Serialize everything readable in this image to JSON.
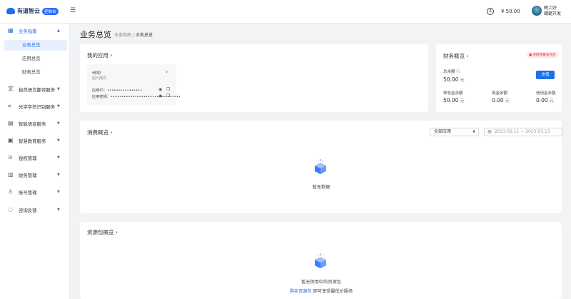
{
  "header": {
    "logo_text": "有道智云",
    "logo_badge": "控制台",
    "balance": "¥ 50.00",
    "user_greeting": "晚上好",
    "user_name": "蜻蜓开发"
  },
  "sidebar": {
    "groups": [
      {
        "label": "业务指南",
        "icon": "grid-icon",
        "chevron": "▲"
      },
      {
        "label": "自然语言翻译服务",
        "icon": "translate-icon",
        "chevron": "▼"
      },
      {
        "label": "光学字符识别服务",
        "icon": "scan-icon",
        "chevron": "▼"
      },
      {
        "label": "智能语音服务",
        "icon": "voice-icon",
        "chevron": "▼"
      },
      {
        "label": "智慧教育服务",
        "icon": "education-icon",
        "chevron": "▼"
      },
      {
        "label": "授权管理",
        "icon": "key-icon",
        "chevron": "▼"
      },
      {
        "label": "财务管理",
        "icon": "wallet-icon",
        "chevron": "▼"
      },
      {
        "label": "账号管理",
        "icon": "user-icon",
        "chevron": "▼"
      },
      {
        "label": "咨询反馈",
        "icon": "chat-icon",
        "chevron": "▼"
      }
    ],
    "sub_items": [
      "业务总览",
      "应用总览",
      "财务总览"
    ]
  },
  "page": {
    "title": "业务总览",
    "breadcrumb_parent": "业务指南",
    "breadcrumb_sep": " / ",
    "breadcrumb_current": "业务总览"
  },
  "my_apps": {
    "title": "我的应用 ›",
    "app_name": "app",
    "app_desc": "图片翻译",
    "app_id_label": "应用ID：",
    "app_id_value": "••••••••••••••••",
    "app_key_label": "应用密钥：",
    "app_key_value": "••••••••••••••••••••••••••••••••"
  },
  "finance": {
    "title": "财务概览 ›",
    "tag": "● 余额预警未开启",
    "total_label": "总余额",
    "total_value": "50.00",
    "unit": "元",
    "recharge": "充值",
    "trial_label": "体验金余额",
    "trial_value": "50.00",
    "cash_label": "现金余额",
    "cash_value": "0.00",
    "credit_label": "信用金余额",
    "credit_value": "0.00"
  },
  "consumption": {
    "title": "消费概览 ›",
    "select_value": "全部应用",
    "date_range": "2023.02.11 ~ 2023.03.13",
    "empty_text": "暂无数据"
  },
  "resource": {
    "title": "资源包概览 ›",
    "empty_text": "暂无使用中的资源包",
    "buy_link": "购买资源包",
    "buy_suffix": " 即可享受最低价服务"
  }
}
